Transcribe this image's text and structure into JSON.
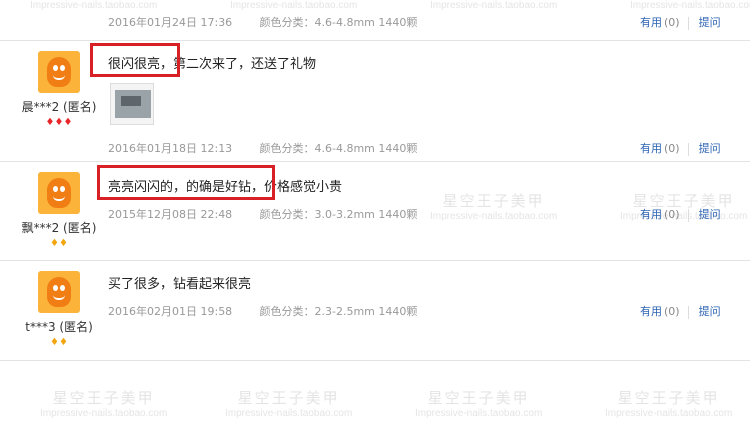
{
  "watermark": {
    "cn": "星空王子美甲",
    "en": "Impressive-nails.taobao.com"
  },
  "reviews": [
    {
      "content": "",
      "date": "2016年01月24日 17:36",
      "spec": "颜色分类：4.6-4.8mm 1440颗",
      "useful": "有用",
      "count": "(0)",
      "ask": "提问"
    },
    {
      "nickname": "晨***2 (匿名)",
      "badges": "♦♦♦",
      "content": "很闪很亮，第二次来了，还送了礼物",
      "date": "2016年01月18日 12:13",
      "spec": "颜色分类：4.6-4.8mm 1440颗",
      "useful": "有用",
      "count": "(0)",
      "ask": "提问"
    },
    {
      "nickname": "飘***2 (匿名)",
      "badges": "♦♦",
      "content": "亮亮闪闪的，的确是好钻，价格感觉小贵",
      "date": "2015年12月08日 22:48",
      "spec": "颜色分类：3.0-3.2mm 1440颗",
      "useful": "有用",
      "count": "(0)",
      "ask": "提问"
    },
    {
      "nickname": "t***3 (匿名)",
      "badges": "♦♦",
      "content": "买了很多，钻看起来很亮",
      "date": "2016年02月01日 19:58",
      "spec": "颜色分类：2.3-2.5mm 1440颗",
      "useful": "有用",
      "count": "(0)",
      "ask": "提问"
    }
  ],
  "colors": {
    "highlight": "#d92025",
    "link": "#2d64b3",
    "meta": "#999999",
    "avatar": "#fbb33a"
  }
}
